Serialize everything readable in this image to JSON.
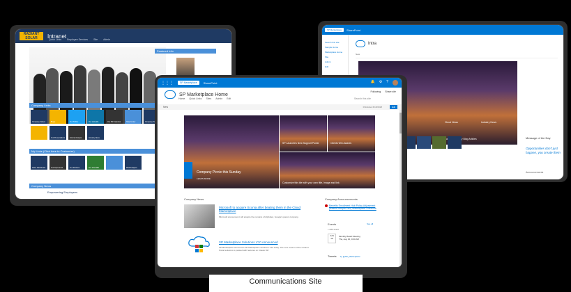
{
  "caption": "Communications Site",
  "intranet": {
    "logo": "RADIANT SOLAR",
    "title": "Intranet",
    "nav": [
      "Quick Links",
      "Employee Services",
      "Site",
      "Admin"
    ],
    "featured_title": "Featured Info",
    "links_title": "Company Links",
    "links_tiles": [
      "Company Videos",
      "Blogs",
      "Our Twitter",
      "Our LinkedIn",
      "Our HR Calendar",
      "Help Center",
      "Company Pictures",
      "",
      "Our Presentations",
      "Internal Groups",
      "Industry News"
    ],
    "mylinks_title": "My Links (Click here to Customize)",
    "mylinks_tiles": [
      "Sales Dashboard",
      "Our Top Funnel",
      "Our Partners",
      "Our Checklist",
      "",
      "Web Analytics"
    ],
    "news_title": "Company News",
    "news_item": "Empowering Employees",
    "colors": {
      "header": "#1f3a63",
      "logo": "#f4b400",
      "bar": "#4a90d9"
    }
  },
  "right_page": {
    "brand": "SP Marketplace",
    "suite": "SharePoint",
    "side_items": [
      "Search this site",
      "Sample Home",
      "Marketplace Home",
      "Site",
      "Admin",
      "Edit"
    ],
    "site_name": "Intra",
    "cmd": "New",
    "hero_labels": [
      "Cloud News",
      "Industry News",
      "Latest Company Blog Articles"
    ],
    "motd_title": "Message of the Day",
    "motd_quote": "Opportunities don't just happen, you create them",
    "announcements": "Announcements"
  },
  "center_page": {
    "brand": "SP Marketplace",
    "suite": "SharePoint",
    "site_name": "SP Marketplace Home",
    "menu": [
      "Home",
      "Quick Links",
      "Sites",
      "Admin",
      "Edit"
    ],
    "follow": "Following",
    "share": "Share site",
    "search_placeholder": "Search this site",
    "cmd_new": "New",
    "published": "Published 6/15/2018",
    "edit": "Edit",
    "hero": {
      "main": "Company Picnic this Sunday",
      "main_sub": "LEARN MORE",
      "tile1": "SP Launches New Support Portal",
      "tile2": "Clients Win Awards",
      "wide": "Customize this tile with your own title, image and link"
    },
    "news_title": "Company News",
    "news1_link": "Microsoft to acquire Sconia after beating them in the Cloud Marketplace",
    "news1_body": "Microsoft announces it will acquire the remains of Alphabet, Google's parent company.",
    "news2_link": "SP Marketplace Solutions V10 Announced",
    "news2_body": "SP Marketplace announces SP Marketplace Solutions V10 today. The new version of the intranet Portal solutions is packed with features on Classic SP.",
    "ann_title": "Company Announcements",
    "ann_item": "Benefits Enrollment Hub Policy Adjustment (Based Sample Dec) Marketplace Solutions",
    "events_title": "Events",
    "events_seeall": "See all",
    "events_add": "+ Add event",
    "event_month": "JUN",
    "event_day": "28",
    "event_name": "Monthly Board Meeting",
    "event_time": "Thu, Aug 30, 9:00 AM",
    "tweets_title": "Tweets",
    "tweets_handle": "by @SP_Marketplace",
    "colors": {
      "suite": "#0078d4"
    }
  }
}
